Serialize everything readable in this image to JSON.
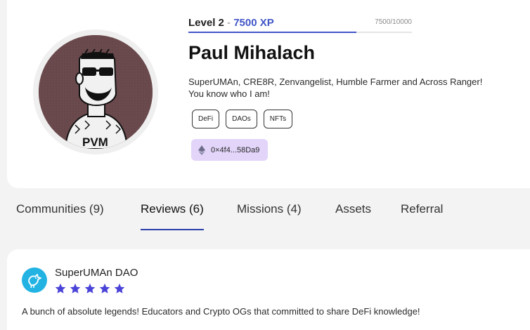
{
  "profile": {
    "level_label": "Level 2",
    "level_separator": "-",
    "xp_label": "7500 XP",
    "xp_count": "7500/10000",
    "xp_progress": 0.75,
    "name": "Paul Mihalach",
    "bio": "SuperUMAn, CRE8R, Zenvangelist, Humble Farmer and Across Ranger! You know who I am!",
    "tags": [
      "DeFi",
      "DAOs",
      "NFTs"
    ],
    "wallet": "0×4f4...58Da9",
    "avatar_icon": "pvm-avatar-icon",
    "colors": {
      "accent": "#4156c7",
      "wallet_bg": "#e2d5f9",
      "avatar_bg": "#6b4a4d"
    }
  },
  "tabs": [
    {
      "label": "Communities (9)",
      "active": false
    },
    {
      "label": "Reviews (6)",
      "active": true
    },
    {
      "label": "Missions (4)",
      "active": false
    },
    {
      "label": "Assets",
      "active": false
    },
    {
      "label": "Referral",
      "active": false
    }
  ],
  "review": {
    "org_name": "SuperUMAn DAO",
    "rating": 5,
    "max_rating": 5,
    "text": "A bunch of absolute legends! Educators and Crypto OGs that committed to share DeFi knowledge!",
    "logo_icon": "bird-icon",
    "colors": {
      "logo_bg": "#22b3e3",
      "star": "#4a43d8"
    }
  }
}
